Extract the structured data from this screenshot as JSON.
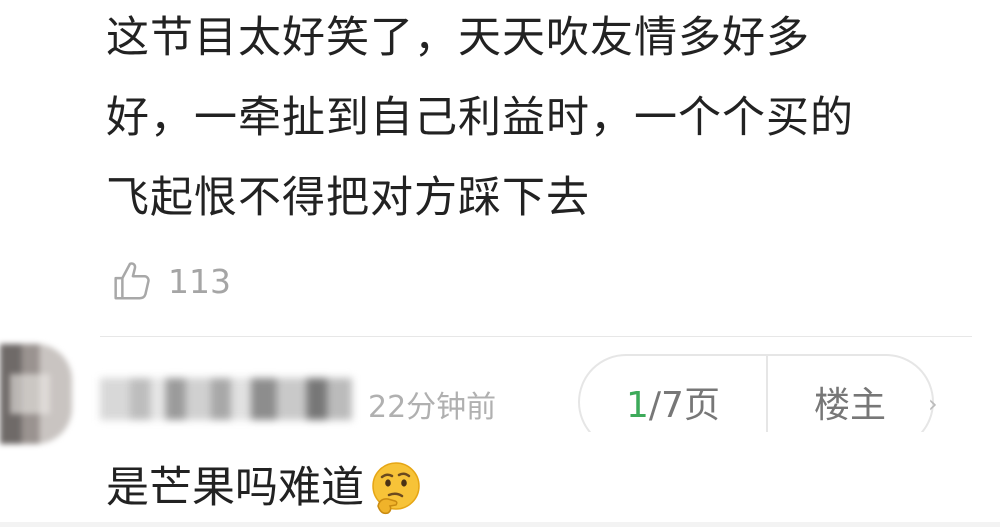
{
  "post": {
    "line1": "这节目太好笑了，天天吹友情多好多",
    "line2": "好，一牵扯到自己利益时，一个个买的",
    "line3": "飞起恨不得把对方踩下去",
    "like_icon": "thumbs-up-icon",
    "like_count": "113"
  },
  "reply": {
    "time": "22分钟前",
    "page_current": "1",
    "page_rest": "/7页",
    "owner_label": "楼主",
    "text": "是芒果吗难道",
    "emoji_icon": "thinking-face-icon"
  }
}
